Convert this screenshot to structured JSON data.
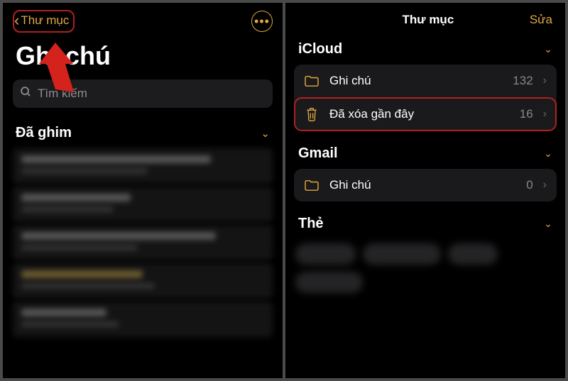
{
  "left": {
    "back_label": "Thư mục",
    "page_title": "Ghi chú",
    "search_placeholder": "Tìm kiếm",
    "pinned_label": "Đã ghim"
  },
  "right": {
    "header_title": "Thư mục",
    "edit_label": "Sửa",
    "accounts": [
      {
        "name": "iCloud",
        "folders": [
          {
            "icon": "folder",
            "label": "Ghi chú",
            "count": "132",
            "highlight": false
          },
          {
            "icon": "trash",
            "label": "Đã xóa gần đây",
            "count": "16",
            "highlight": true
          }
        ]
      },
      {
        "name": "Gmail",
        "folders": [
          {
            "icon": "folder",
            "label": "Ghi chú",
            "count": "0",
            "highlight": false
          }
        ]
      }
    ],
    "tags_label": "Thẻ"
  }
}
